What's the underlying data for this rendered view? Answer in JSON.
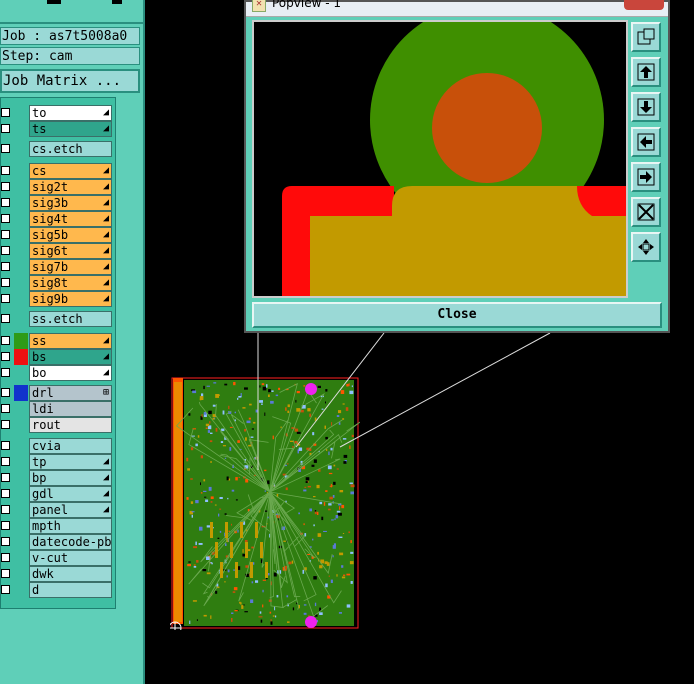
{
  "job": {
    "job_label": "Job : as7t5008a0",
    "step_label": "Step: cam",
    "matrix_button": "Job Matrix ..."
  },
  "layers": [
    {
      "name": "to",
      "fill": "#ffffff",
      "swatch": "",
      "arrow": "◢"
    },
    {
      "name": "ts",
      "fill": "#2fa58c",
      "swatch": "",
      "arrow": "◢"
    },
    {
      "name": "cs.etch",
      "fill": "#9ad9d6",
      "swatch": "",
      "arrow": ""
    },
    {
      "name": "cs",
      "fill": "#ffb84d",
      "swatch": "",
      "arrow": "◢"
    },
    {
      "name": "sig2t",
      "fill": "#ffb84d",
      "swatch": "",
      "arrow": "◢"
    },
    {
      "name": "sig3b",
      "fill": "#ffb84d",
      "swatch": "",
      "arrow": "◢"
    },
    {
      "name": "sig4t",
      "fill": "#ffb84d",
      "swatch": "",
      "arrow": "◢"
    },
    {
      "name": "sig5b",
      "fill": "#ffb84d",
      "swatch": "",
      "arrow": "◢"
    },
    {
      "name": "sig6t",
      "fill": "#ffb84d",
      "swatch": "",
      "arrow": "◢"
    },
    {
      "name": "sig7b",
      "fill": "#ffb84d",
      "swatch": "",
      "arrow": "◢"
    },
    {
      "name": "sig8t",
      "fill": "#ffb84d",
      "swatch": "",
      "arrow": "◢"
    },
    {
      "name": "sig9b",
      "fill": "#ffb84d",
      "swatch": "",
      "arrow": "◢"
    },
    {
      "name": "ss.etch",
      "fill": "#9ad9d6",
      "swatch": "",
      "arrow": ""
    },
    {
      "name": "ss",
      "fill": "#ffb84d",
      "swatch": "#2e9b17",
      "arrow": "◢"
    },
    {
      "name": "bs",
      "fill": "#2fa58c",
      "swatch": "#ee1111",
      "arrow": "◢"
    },
    {
      "name": "bo",
      "fill": "#ffffff",
      "swatch": "",
      "arrow": "◢"
    },
    {
      "name": "drl",
      "fill": "#b4c4cc",
      "swatch": "#1133cc",
      "arrow": "⊞"
    },
    {
      "name": "ldi",
      "fill": "#b4c4cc",
      "swatch": "",
      "arrow": ""
    },
    {
      "name": "rout",
      "fill": "#e4e4e4",
      "swatch": "",
      "arrow": ""
    },
    {
      "name": "cvia",
      "fill": "#9ad9d6",
      "swatch": "",
      "arrow": ""
    },
    {
      "name": "tp",
      "fill": "#9ad9d6",
      "swatch": "",
      "arrow": "◢"
    },
    {
      "name": "bp",
      "fill": "#9ad9d6",
      "swatch": "",
      "arrow": "◢"
    },
    {
      "name": "gdl",
      "fill": "#9ad9d6",
      "swatch": "",
      "arrow": "◢"
    },
    {
      "name": "panel",
      "fill": "#9ad9d6",
      "swatch": "",
      "arrow": "◢"
    },
    {
      "name": "mpth",
      "fill": "#9ad9d6",
      "swatch": "",
      "arrow": ""
    },
    {
      "name": "datecode-pbc",
      "fill": "#9ad9d6",
      "swatch": "",
      "arrow": ""
    },
    {
      "name": "v-cut",
      "fill": "#9ad9d6",
      "swatch": "",
      "arrow": ""
    },
    {
      "name": "dwk",
      "fill": "#9ad9d6",
      "swatch": "",
      "arrow": ""
    },
    {
      "name": "d",
      "fill": "#9ad9d6",
      "swatch": "",
      "arrow": ""
    }
  ],
  "popup": {
    "title": "Popview - 1",
    "close_label": "Close"
  },
  "colors": {
    "panel": "#5fcfb8",
    "board_green": "#3f8f00",
    "pad_orange": "#c8500a",
    "fill_gold": "#c29a00",
    "copper_red": "#ff0a0a"
  }
}
